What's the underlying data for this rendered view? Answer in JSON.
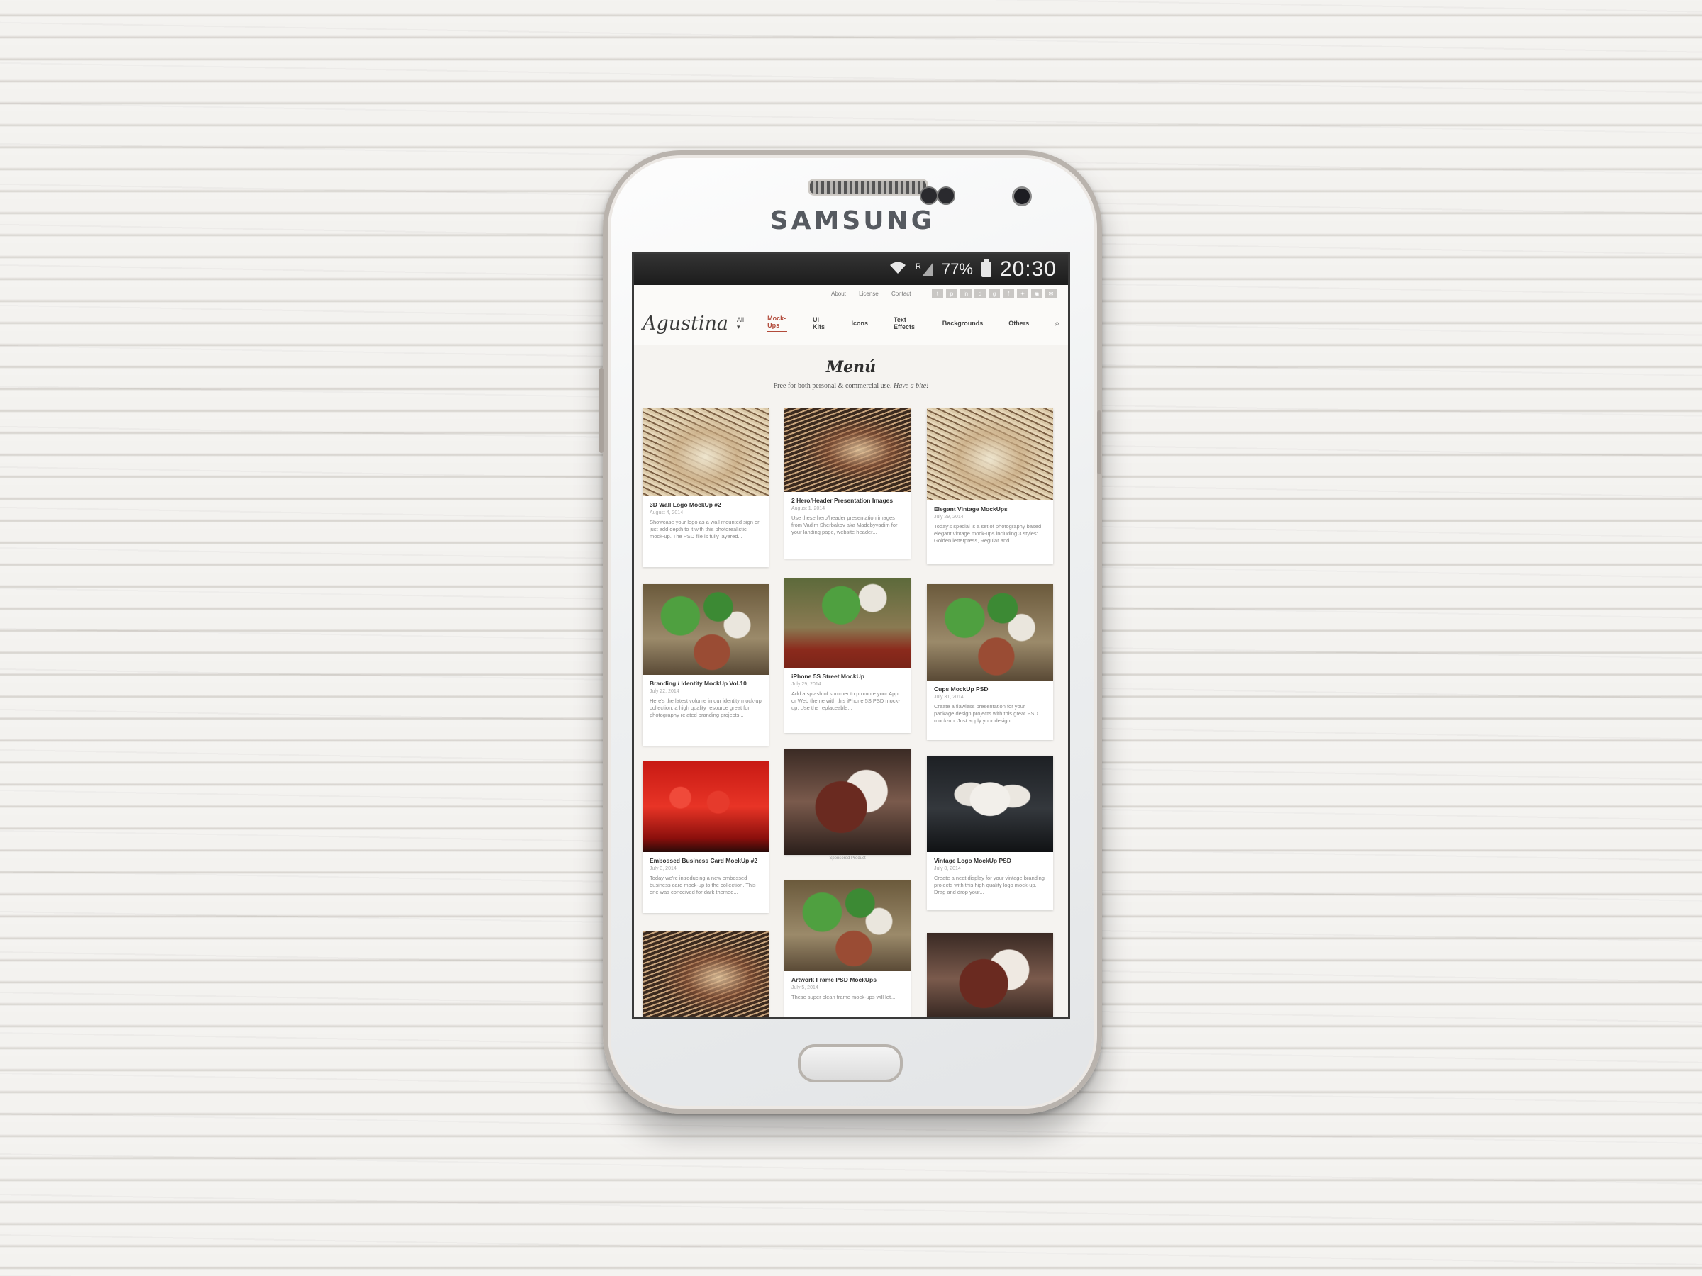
{
  "device": {
    "brand": "SAMSUNG"
  },
  "statusbar": {
    "roaming": "R",
    "battery": "77%",
    "time": "20:30"
  },
  "toplinks": [
    "About",
    "License",
    "Contact"
  ],
  "social_icons": [
    "t-icon",
    "p-icon",
    "in-icon",
    "d-icon",
    "g-icon",
    "f-icon",
    "twitter-icon",
    "rss-icon",
    "mail-icon"
  ],
  "nav": {
    "logo": "Agustina",
    "all": "All",
    "items": [
      "Mock-Ups",
      "UI Kits",
      "Icons",
      "Text Effects",
      "Backgrounds",
      "Others"
    ],
    "active": "Mock-Ups"
  },
  "hero": {
    "title": "Menú",
    "subtitle": "Free for both personal & commercial use.",
    "subtitle_em": "Have a bite!"
  },
  "cards": [
    {
      "title": "3D Wall Logo MockUp #2",
      "date": "August 4, 2014",
      "excerpt": "Showcase your logo as a wall mounted sign or just add depth to it with this photorealistic mock-up. The PSD file is fully layered..."
    },
    {
      "title": "2 Hero/Header Presentation Images",
      "date": "August 1, 2014",
      "excerpt": "Use these hero/header presentation images from Vadim Sherbakov aka Madebyvadim for your landing page, website header..."
    },
    {
      "title": "Elegant Vintage MockUps",
      "date": "July 29, 2014",
      "excerpt": "Today's special is a set of photography based elegant vintage mock-ups including 3 styles: Golden letterpress, Regular and..."
    },
    {
      "title": "Branding / Identity MockUp Vol.10",
      "date": "July 22, 2014",
      "excerpt": "Here's the latest volume in our identity mock-up collection, a high quality resource great for photography related branding projects..."
    },
    {
      "title": "iPhone 5S Street MockUp",
      "date": "July 29, 2014",
      "excerpt": "Add a splash of summer to promote your App or Web theme with this iPhone 5S PSD mock-up. Use the replaceable..."
    },
    {
      "title": "Cups MockUp PSD",
      "date": "July 31, 2014",
      "excerpt": "Create a flawless presentation for your package design projects with this great PSD mock-up. Just apply your design..."
    },
    {
      "title": "Embossed Business Card MockUp #2",
      "date": "July 3, 2014",
      "excerpt": "Today we're introducing a new embossed business card mock-up to the collection. This one was conceived for dark themed..."
    },
    {
      "title": "Vintage Logo MockUp PSD",
      "date": "July 8, 2014",
      "excerpt": "Create a neat display for your vintage branding projects with this high quality logo mock-up. Drag and drop your..."
    },
    {
      "title": "Artwork Frame PSD MockUps",
      "date": "July 5, 2014",
      "excerpt": "These super clean frame mock-ups will let..."
    }
  ],
  "sponsored_caption": "Sponsored Product"
}
